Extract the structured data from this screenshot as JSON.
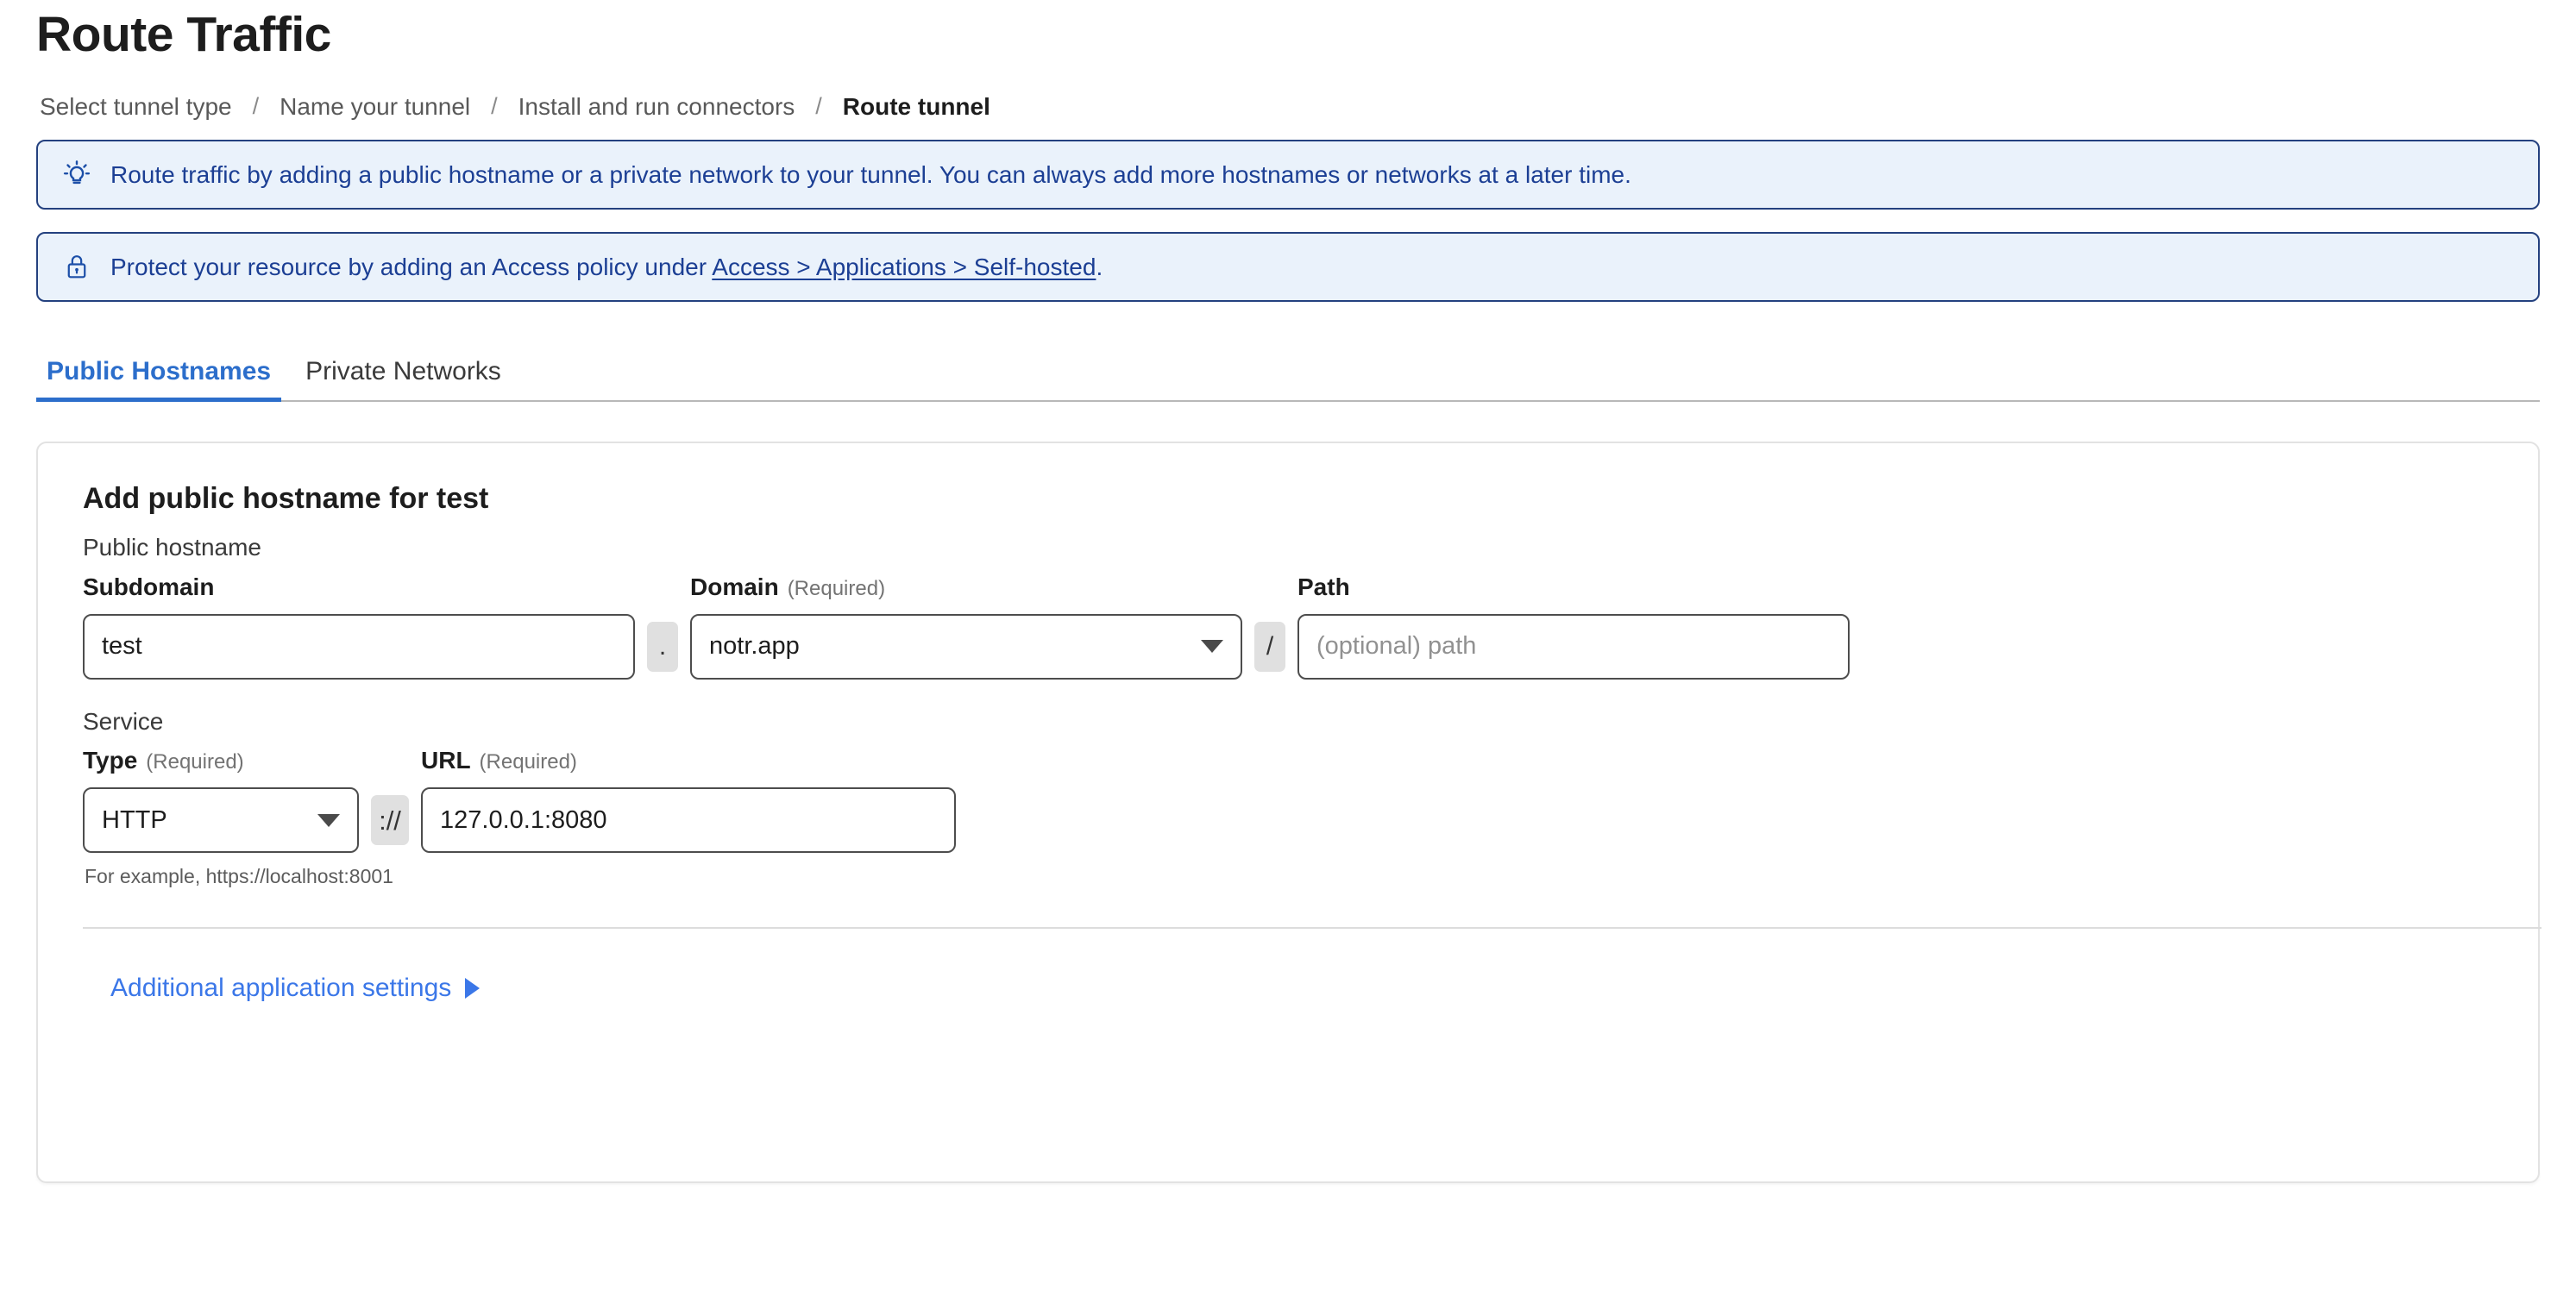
{
  "header": {
    "title": "Route Traffic"
  },
  "breadcrumb": {
    "separator": "/",
    "items": [
      {
        "label": "Select tunnel type",
        "active": false
      },
      {
        "label": "Name your tunnel",
        "active": false
      },
      {
        "label": "Install and run connectors",
        "active": false
      },
      {
        "label": "Route tunnel",
        "active": true
      }
    ]
  },
  "banners": [
    {
      "icon": "lightbulb-icon",
      "text": "Route traffic by adding a public hostname or a private network to your tunnel. You can always add more hostnames or networks at a later time.",
      "link_text": "",
      "border_color": "#24417f",
      "background_color": "#eaf2fb",
      "text_color": "#1c3f94"
    },
    {
      "icon": "lock-icon",
      "text_before": "Protect your resource by adding an Access policy under ",
      "link_text": "Access > Applications > Self-hosted",
      "text_after": ".",
      "border_color": "#24417f",
      "background_color": "#eaf2fb",
      "text_color": "#1c3f94"
    }
  ],
  "tabs": [
    {
      "label": "Public Hostnames",
      "selected": true
    },
    {
      "label": "Private Networks",
      "selected": false
    }
  ],
  "accent_color": "#2c6ecb",
  "link_color": "#3b77e8",
  "card": {
    "title": "Add public hostname for test",
    "public_hostname_label": "Public hostname",
    "service_label": "Service",
    "subdomain": {
      "label": "Subdomain",
      "required_note": "",
      "value": "test",
      "placeholder": ""
    },
    "dot_joiner": ".",
    "domain": {
      "label": "Domain",
      "required_note": "(Required)",
      "value": "notr.app"
    },
    "slash_joiner": "/",
    "path": {
      "label": "Path",
      "required_note": "",
      "value": "",
      "placeholder": "(optional) path"
    },
    "type": {
      "label": "Type",
      "required_note": "(Required)",
      "value": "HTTP"
    },
    "scheme_joiner": "://",
    "url": {
      "label": "URL",
      "required_note": "(Required)",
      "value": "127.0.0.1:8080",
      "placeholder": ""
    },
    "url_hint": "For example, https://localhost:8001",
    "additional_settings_label": "Additional application settings"
  }
}
